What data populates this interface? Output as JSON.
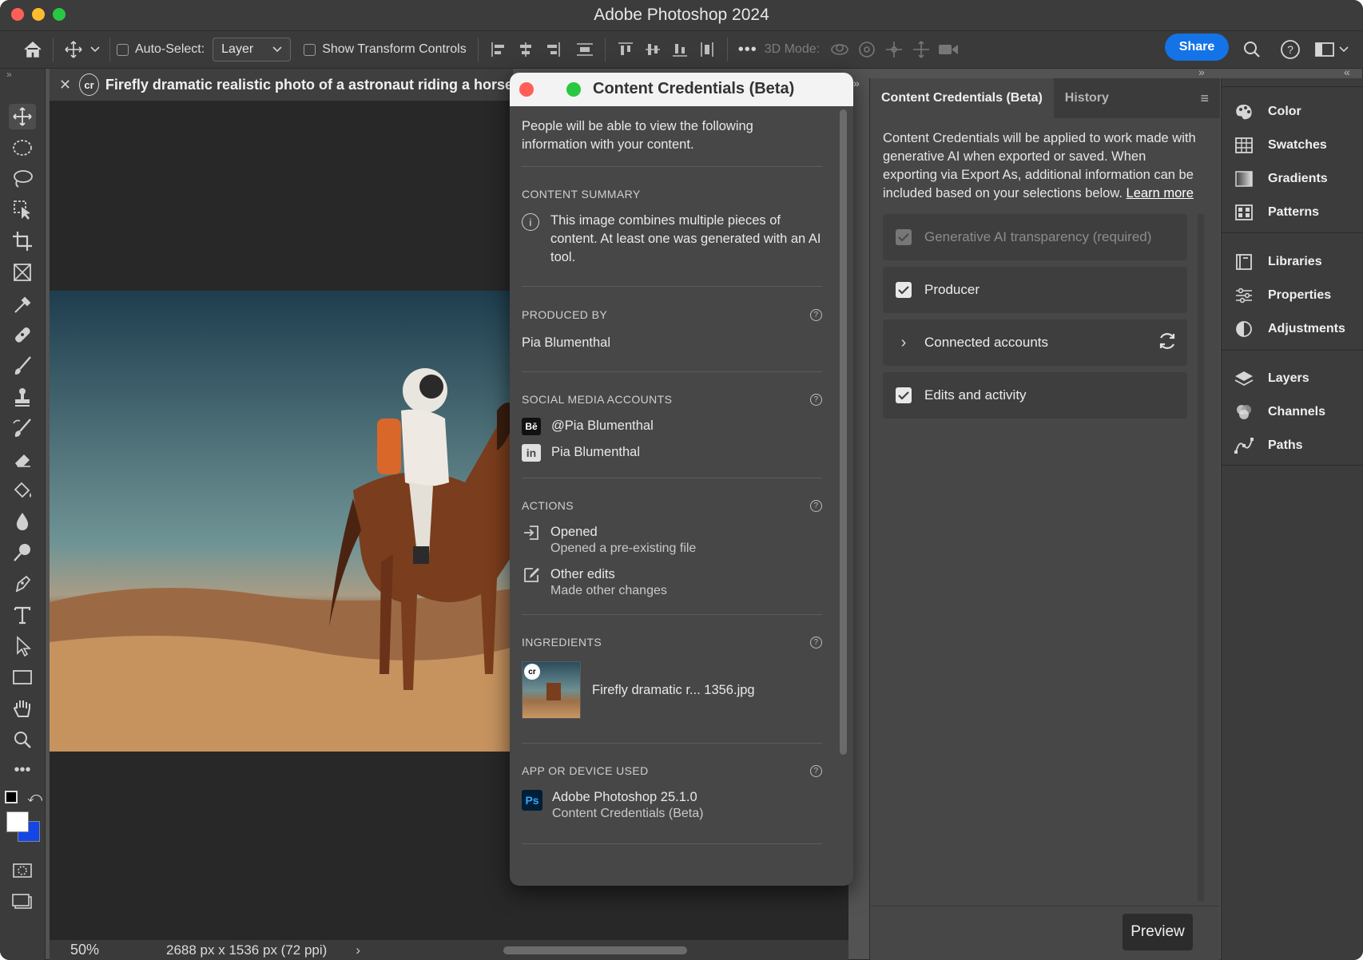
{
  "app": {
    "title": "Adobe Photoshop 2024"
  },
  "options_bar": {
    "auto_select_label": "Auto-Select:",
    "auto_select_value": "Layer",
    "show_transform_label": "Show Transform Controls",
    "mode_3d_label": "3D Mode:",
    "share_label": "Share"
  },
  "document": {
    "tab_title": "Firefly dramatic realistic photo of a astronaut riding a horse",
    "zoom": "50%",
    "info": "2688 px x 1536 px (72 ppi)"
  },
  "dialog": {
    "title": "Content Credentials (Beta)",
    "intro": "People will be able to view the following information with your content.",
    "content_summary": {
      "heading": "CONTENT SUMMARY",
      "text": "This image combines multiple pieces of content. At least one was generated with an AI tool."
    },
    "produced_by": {
      "heading": "PRODUCED BY",
      "name": "Pia Blumenthal"
    },
    "social": {
      "heading": "SOCIAL MEDIA ACCOUNTS",
      "accounts": [
        {
          "icon": "behance-icon",
          "glyph": "Bē",
          "name": "@Pia Blumenthal"
        },
        {
          "icon": "linkedin-icon",
          "glyph": "in",
          "name": "Pia Blumenthal"
        }
      ]
    },
    "actions": {
      "heading": "ACTIONS",
      "items": [
        {
          "title": "Opened",
          "desc": "Opened a pre-existing file"
        },
        {
          "title": "Other edits",
          "desc": "Made other changes"
        }
      ]
    },
    "ingredients": {
      "heading": "INGREDIENTS",
      "file": "Firefly dramatic r... 1356.jpg"
    },
    "app_used": {
      "heading": "APP OR DEVICE USED",
      "app": "Adobe Photoshop 25.1.0",
      "sub": "Content Credentials (Beta)"
    }
  },
  "right_panel": {
    "tabs": [
      "Content Credentials (Beta)",
      "History"
    ],
    "description": "Content Credentials will be applied to work made with generative AI when exported or saved. When exporting via Export As, additional information can be included based on your selections below.",
    "learn_more": "Learn more",
    "options": [
      {
        "label": "Generative AI transparency (required)",
        "checked": true,
        "disabled": true
      },
      {
        "label": "Producer",
        "checked": true,
        "disabled": false
      },
      {
        "label": "Connected accounts",
        "expandable": true
      },
      {
        "label": "Edits and activity",
        "checked": true,
        "disabled": false
      }
    ],
    "preview_label": "Preview"
  },
  "dock": {
    "groups": [
      [
        "Color",
        "Swatches",
        "Gradients",
        "Patterns"
      ],
      [
        "Libraries",
        "Properties",
        "Adjustments"
      ],
      [
        "Layers",
        "Channels",
        "Paths"
      ]
    ]
  },
  "colors": {
    "accent": "#1473e6",
    "foreground": "#ffffff",
    "background": "#1446e6"
  }
}
